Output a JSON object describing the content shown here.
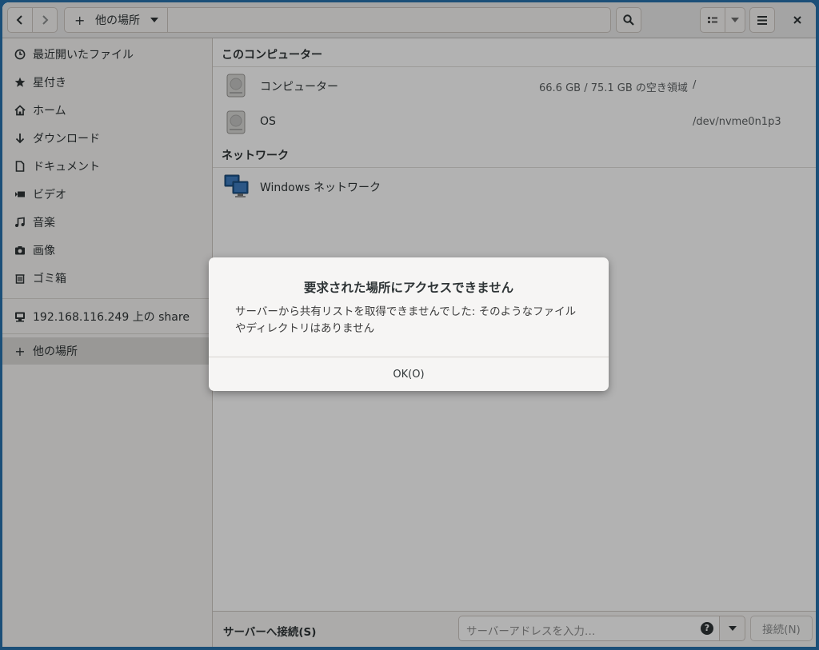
{
  "header": {
    "path_add_symbol": "+",
    "path_label": "他の場所"
  },
  "sidebar": {
    "items": [
      {
        "label": "最近開いたファイル",
        "icon": "clock-icon"
      },
      {
        "label": "星付き",
        "icon": "star-icon"
      },
      {
        "label": "ホーム",
        "icon": "home-icon"
      },
      {
        "label": "ダウンロード",
        "icon": "download-icon"
      },
      {
        "label": "ドキュメント",
        "icon": "document-icon"
      },
      {
        "label": "ビデオ",
        "icon": "video-icon"
      },
      {
        "label": "音楽",
        "icon": "music-icon"
      },
      {
        "label": "画像",
        "icon": "camera-icon"
      },
      {
        "label": "ゴミ箱",
        "icon": "trash-icon"
      }
    ],
    "network_share": "192.168.116.249 上の share",
    "other_locations": "他の場所",
    "other_locations_symbol": "+"
  },
  "main": {
    "section_computer": "このコンピューター",
    "computer_row": {
      "name": "コンピューター",
      "space": "66.6 GB / 75.1 GB の空き領域",
      "mount": "/"
    },
    "os_row": {
      "name": "OS",
      "device": "/dev/nvme0n1p3"
    },
    "section_network": "ネットワーク",
    "network_row": {
      "name": "Windows ネットワーク"
    }
  },
  "bottom": {
    "connect_label": "サーバーへ接続(S)",
    "address_placeholder": "サーバーアドレスを入力…",
    "help_symbol": "?",
    "connect_button": "接続(N)"
  },
  "dialog": {
    "title": "要求された場所にアクセスできません",
    "message_line1": "サーバーから共有リストを取得できませんでした: そのようなファイル",
    "message_line2": "やディレクトリはありません",
    "ok_label": "OK(O)"
  },
  "colors": {
    "desktop": "#1b4f78",
    "window_bg": "#f6f5f4",
    "selection": "#dcdad7",
    "dim_overlay": "rgba(0,0,0,0.30)"
  }
}
